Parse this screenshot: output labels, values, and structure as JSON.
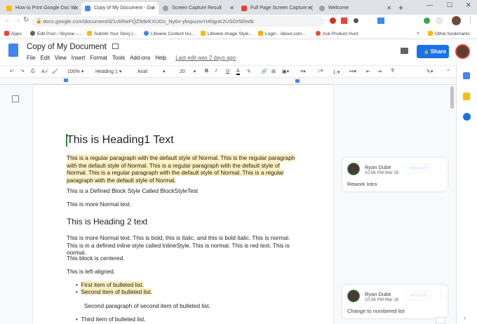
{
  "browser": {
    "tabs": [
      {
        "title": "How to Print Google Doc W",
        "icon_color": "#fbbc04",
        "active": false
      },
      {
        "title": "Copy of My Document - Go",
        "icon_color": "#4285f4",
        "active": true
      },
      {
        "title": "Screen Capture Result",
        "icon_color": "#9aa0a6",
        "active": false
      },
      {
        "title": "Full Page Screen Capture - (",
        "icon_color": "#ea4335",
        "active": false
      },
      {
        "title": "Welcome",
        "icon_color": "#9aa0a6",
        "active": false
      }
    ],
    "url": "docs.google.com/document/d/1ckRwFQZ9deKXUGs_Ny6x-ybspuzwYi40goK2USOr5il/edit",
    "bookmarks": [
      {
        "label": "Apps",
        "color": "#ea4335"
      },
      {
        "label": "Edit Post ‹ Skyose –...",
        "color": "#5f6368"
      },
      {
        "label": "Submit Your Story |...",
        "color": "#fbbc04"
      },
      {
        "label": "Lifewire Content Hu...",
        "color": "#4285f4"
      },
      {
        "label": "Lifewire Image Style...",
        "color": "#fbbc04"
      },
      {
        "label": "Login - About.com...",
        "color": "#f9ab00"
      },
      {
        "label": "Ask Product Hunt",
        "color": "#da552f"
      }
    ],
    "other_bookmarks": "Other bookmarks"
  },
  "doc": {
    "title": "Copy of My Document",
    "menus": [
      "File",
      "Edit",
      "View",
      "Insert",
      "Format",
      "Tools",
      "Add-ons",
      "Help"
    ],
    "last_edit": "Last edit was 2 days ago",
    "share_label": "Share",
    "accent": "#1a73e8"
  },
  "toolbar": {
    "zoom": "100%",
    "style": "Heading 1",
    "font": "Arial",
    "size": "20"
  },
  "content": {
    "heading1": "This is Heading1 Text",
    "para1": "This is a regular paragraph with the default style of Normal. This is the regular paragraph with the default style of Normal. This is a regular paragraph with the default style of Normal. This is a regular paragraph with the default style of Normal. This is a regular paragraph with the default style of Normal.",
    "block_style": "This is a Defined Block Style Called BlockStyleTest",
    "more_normal": "This is more Normal text.",
    "heading2": "This is Heading 2 text",
    "para2": "This is more Normal text. This is bold, this is italic, and this is bold italic. This is normal. This is in a defined inline style called InlineStyle. This is normal. This is red text. This is normal.",
    "centered": "This block is centered.",
    "left_aligned": "This is left-aligned.",
    "bullet1": "First item of bulleted list.",
    "bullet2": "Second item of bulleted list.",
    "bullet2_para": "Second paragraph of second item of bulleted list.",
    "bullet3": "Third item of bulleted list.",
    "highlight_color": "#fdefbe"
  },
  "comments": [
    {
      "author": "Ryan Dube",
      "time": "10:56 PM Mar 18",
      "text": "Rework Intro",
      "resolve": "Resolve"
    },
    {
      "author": "Ryan Dube",
      "time": "10:56 PM Mar 18",
      "text": "Change to numbered list",
      "resolve": "Resolve"
    }
  ]
}
